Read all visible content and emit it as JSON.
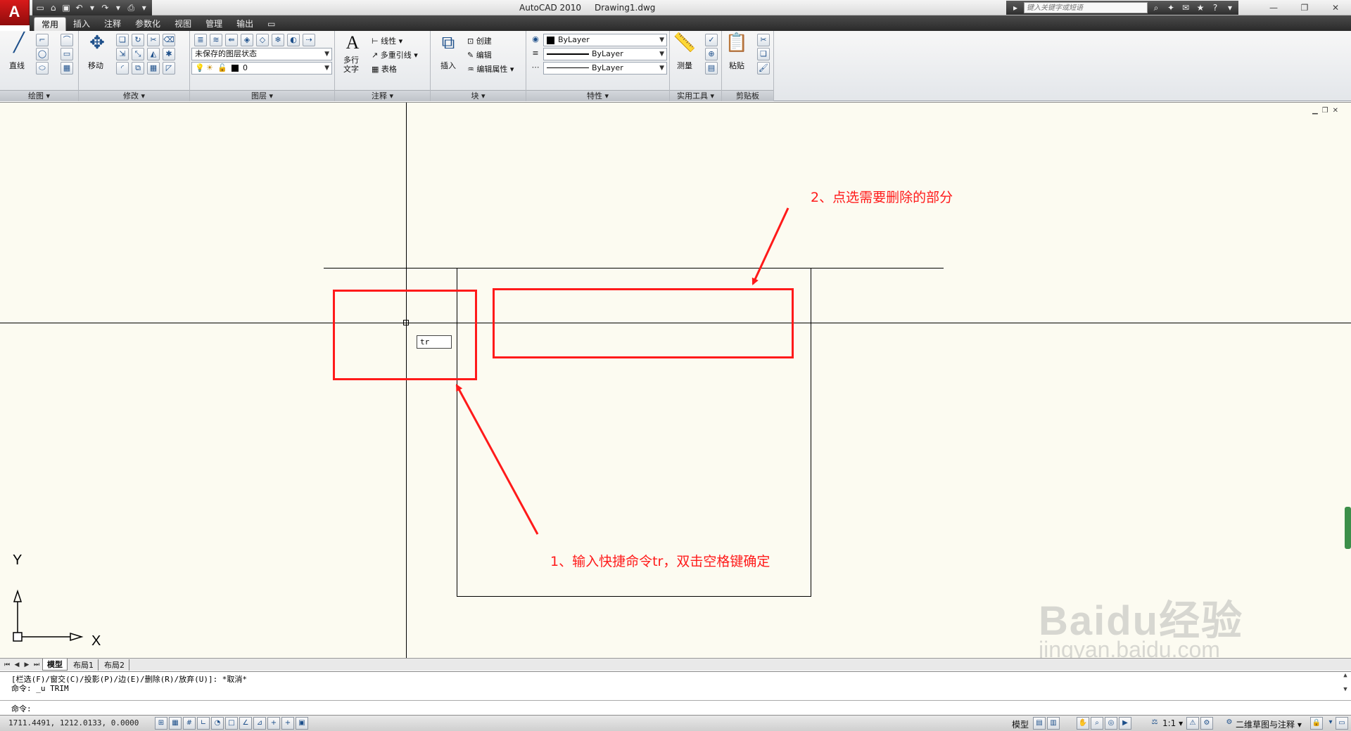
{
  "titlebar": {
    "app_name": "AutoCAD 2010",
    "file_name": "Drawing1.dwg",
    "search_placeholder": "键入关键字或短语"
  },
  "ribbon_tabs": [
    "常用",
    "插入",
    "注释",
    "参数化",
    "视图",
    "管理",
    "输出"
  ],
  "ribbon": {
    "draw": {
      "title": "绘图",
      "line_label": "直线"
    },
    "modify": {
      "title": "修改",
      "move_label": "移动"
    },
    "layers": {
      "title": "图层",
      "layer_state": "未保存的图层状态",
      "current_layer": "0"
    },
    "annotation": {
      "title": "注释",
      "mtext_label1": "多行",
      "mtext_label2": "文字",
      "linear_label": "线性",
      "multileader_label": "多重引线",
      "table_label": "表格"
    },
    "block": {
      "title": "块",
      "insert_label": "插入",
      "create_label": "创建",
      "edit_label": "编辑",
      "edit_attr_label": "编辑属性"
    },
    "properties": {
      "title": "特性",
      "color": "ByLayer",
      "linetype": "ByLayer",
      "lineweight": "ByLayer"
    },
    "utilities": {
      "title": "实用工具",
      "measure_label": "测量"
    },
    "clipboard": {
      "title": "剪贴板",
      "paste_label": "粘贴"
    }
  },
  "canvas": {
    "dynamic_input": "tr",
    "annotation_1": "1、输入快捷命令tr，双击空格键确定",
    "annotation_2": "2、点选需要删除的部分",
    "ucs_y": "Y",
    "ucs_x": "X",
    "watermark_logo": "Baidu经验",
    "watermark_url": "jingyan.baidu.com"
  },
  "layout_tabs": [
    "模型",
    "布局1",
    "布局2"
  ],
  "command_line": {
    "history_1": "[栏选(F)/窗交(C)/投影(P)/边(E)/删除(R)/放弃(U)]:  *取消*",
    "history_2": "命令: _u TRIM",
    "prompt": "命令:"
  },
  "statusbar": {
    "coordinates": "1711.4491, 1212.0133, 0.0000",
    "model_label": "模型",
    "scale_label": "1:1",
    "workspace_label": "二维草图与注释"
  },
  "colors": {
    "canvas_bg": "#fcfbf1",
    "annotation_red": "#ff1a1a",
    "ribbon_dark": "#2a2a2a"
  }
}
